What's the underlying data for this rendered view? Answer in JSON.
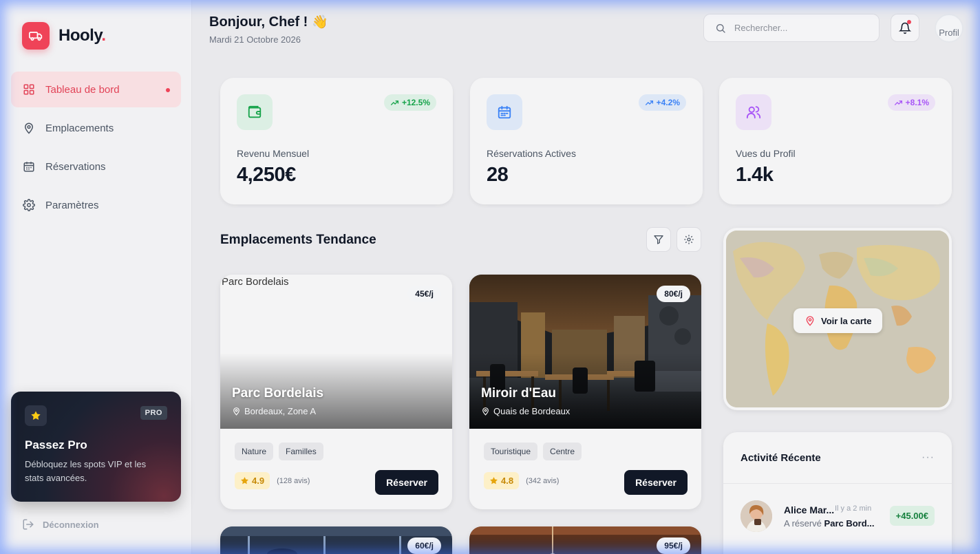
{
  "brand": {
    "name": "Hooly",
    "dot": ".",
    "accent": "#ef4358"
  },
  "sidebar": {
    "items": [
      {
        "label": "Tableau de bord",
        "icon": "grid-icon",
        "active": true
      },
      {
        "label": "Emplacements",
        "icon": "map-pin-icon",
        "active": false
      },
      {
        "label": "Réservations",
        "icon": "calendar-icon",
        "active": false
      },
      {
        "label": "Paramètres",
        "icon": "gear-icon",
        "active": false
      }
    ],
    "pro": {
      "badge": "PRO",
      "title": "Passez Pro",
      "description": "Débloquez les spots VIP et les stats avancées."
    },
    "logout": "Déconnexion"
  },
  "header": {
    "greeting": "Bonjour, Chef !",
    "emoji": "👋",
    "date": "Mardi 21 Octobre 2026",
    "search_placeholder": "Rechercher...",
    "avatar_alt": "Profil"
  },
  "stats": [
    {
      "label": "Revenu Mensuel",
      "value": "4,250€",
      "trend": "+12.5%",
      "color": "#16a34a",
      "bg": "#dcefe4",
      "icon": "wallet-icon"
    },
    {
      "label": "Réservations Actives",
      "value": "28",
      "trend": "+4.2%",
      "color": "#3b82f6",
      "bg": "#dde7f6",
      "icon": "calendar-icon"
    },
    {
      "label": "Vues du Profil",
      "value": "1.4k",
      "trend": "+8.1%",
      "color": "#a855f7",
      "bg": "#ece1f6",
      "icon": "users-icon"
    }
  ],
  "trending": {
    "title": "Emplacements Tendance",
    "book_label": "Réserver",
    "cards": [
      {
        "name": "Parc Bordelais",
        "address": "Bordeaux, Zone A",
        "price": "45€/j",
        "tags": [
          "Nature",
          "Familles"
        ],
        "rating": "4.9",
        "reviews": "(128 avis)",
        "image_alt": "Parc Bordelais"
      },
      {
        "name": "Miroir d'Eau",
        "address": "Quais de Bordeaux",
        "price": "80€/j",
        "tags": [
          "Touristique",
          "Centre"
        ],
        "rating": "4.8",
        "reviews": "(342 avis)"
      },
      {
        "price": "60€/j"
      },
      {
        "price": "95€/j"
      }
    ]
  },
  "map": {
    "button": "Voir la carte"
  },
  "activity": {
    "title": "Activité Récente",
    "more": "···",
    "items": [
      {
        "name": "Alice Mar...",
        "time": "Il y a 2 min",
        "action": "A réservé",
        "place": "Parc Bord...",
        "amount": "+45.00€"
      }
    ]
  }
}
